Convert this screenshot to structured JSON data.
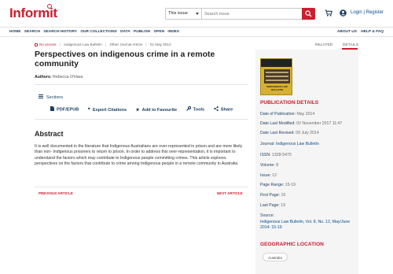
{
  "header": {
    "logo_text": "Informit",
    "search": {
      "scope": "This issue",
      "placeholder": "Search issue"
    },
    "login_label": "Login | Register",
    "brand_color": "#c8202f"
  },
  "nav": {
    "left": [
      "HOME",
      "SEARCH",
      "SEARCH HISTORY",
      "OUR COLLECTIONS",
      "DATA",
      "PUBLISH",
      "OPEN",
      "INDEX"
    ],
    "right": [
      "ABOUT US",
      "HELP & FAQ"
    ]
  },
  "article": {
    "access": "No access",
    "publication": "Indigenous Law Bulletin",
    "type": "Other Journal Article",
    "date": "01 May 2014",
    "title": "Perspectives on indigenous crime in a remote community",
    "authors_label": "Authors:",
    "author": "Rebecca O'Hara",
    "sections_label": "Sections",
    "actions": [
      {
        "icon": "pdf-icon",
        "label": "PDF/EPUB"
      },
      {
        "icon": "quote-icon",
        "label": "Export Citations"
      },
      {
        "icon": "star-icon",
        "label": "Add to Favourite"
      },
      {
        "icon": "wrench-icon",
        "label": "Tools"
      },
      {
        "icon": "share-icon",
        "label": "Share"
      }
    ],
    "abstract_heading": "Abstract",
    "abstract": "It is well documented in the literature that Indigenous Australians are over-represented in prison and are more likely than non- Indigenous prisoners to return to prison. In order to address this over-representation, it is important to understand the factors which may contribute to Indigenous people committing crimes. This article explores perspectives on the factors that contribute to crime among Indigenous people in a remote community in Australia.",
    "prev_label": "PREVIOUS ARTICLE",
    "next_label": "NEXT ARTICLE"
  },
  "sidebar": {
    "tabs": [
      "RELATED",
      "DETAILS"
    ],
    "active_tab": "DETAILS",
    "cover_text": "INDIGENOUS LAW BULLETIN",
    "pub_heading": "PUBLICATION DETAILS",
    "details": [
      {
        "label": "Date of Publication:",
        "value": "May 2014"
      },
      {
        "label": "Date Last Modified:",
        "value": "02 November 2017 11:47"
      },
      {
        "label": "Date Last Revised:",
        "value": "09 July 2014"
      },
      {
        "label": "Journal:",
        "value": "Indigenous Law Bulletin"
      },
      {
        "label": "ISSN:",
        "value": "1328-5475"
      },
      {
        "label": "Volume:",
        "value": "8"
      },
      {
        "label": "Issue:",
        "value": "12"
      },
      {
        "label": "Page Range:",
        "value": "15-19"
      },
      {
        "label": "First Page:",
        "value": "15"
      },
      {
        "label": "Last Page:",
        "value": "19"
      }
    ],
    "source_label": "Source:",
    "source_value": "Indigenous Law Bulletin, Vol. 8, No. 12, May/June 2014: 15-19",
    "geo_heading": "GEOGRAPHIC LOCATION",
    "geo_tag": "Australia"
  }
}
